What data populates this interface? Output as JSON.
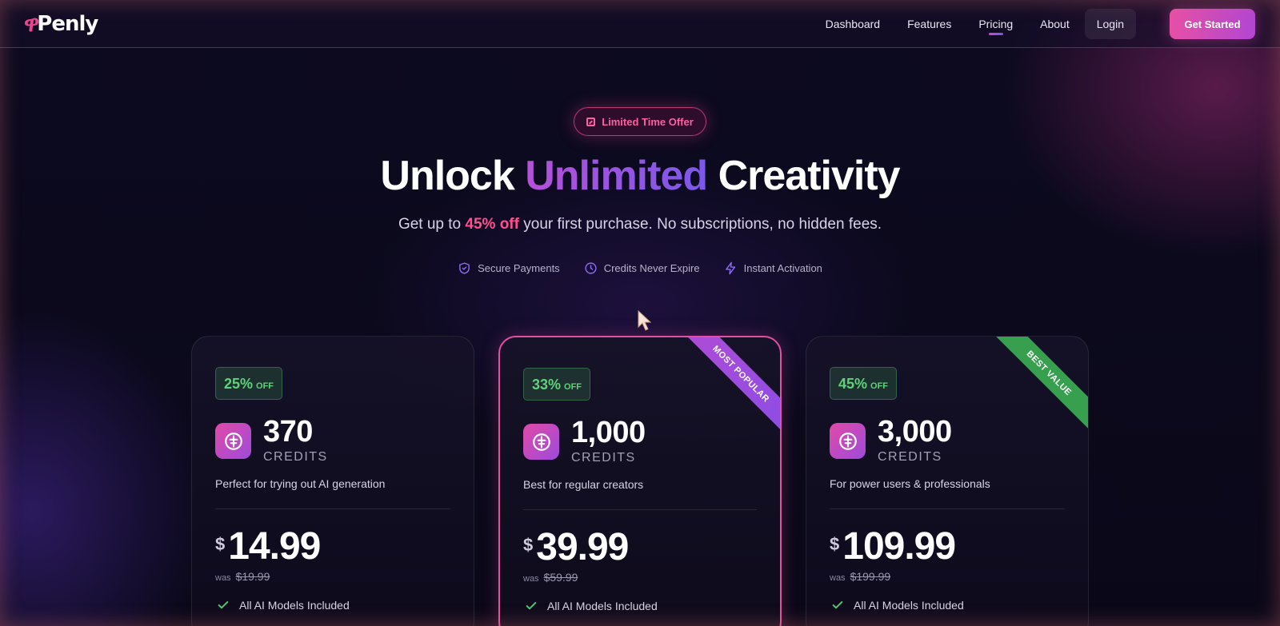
{
  "nav": {
    "logo": "Penly",
    "links": [
      "Dashboard",
      "Features",
      "Pricing",
      "About"
    ],
    "active": "Pricing",
    "login": "Login",
    "cta": "Get Started"
  },
  "hero": {
    "pill": "Limited Time Offer",
    "headline_pre": "Unlock ",
    "headline_accent": "Unlimited",
    "headline_post": " Creativity",
    "sub_pre": "Get up to ",
    "sub_highlight": "45% off",
    "sub_post": " your first purchase. No subscriptions, no hidden fees.",
    "features": [
      {
        "label": "Secure Payments",
        "icon": "shield-icon"
      },
      {
        "label": "Credits Never Expire",
        "icon": "clock-icon"
      },
      {
        "label": "Instant Activation",
        "icon": "lightning-icon"
      }
    ]
  },
  "plans": [
    {
      "discount": "25%",
      "off": "OFF",
      "credits": "370",
      "credits_label": "CREDITS",
      "description": "Perfect for trying out AI generation",
      "currency": "$",
      "price": "14.99",
      "was_label": "was",
      "was_price": "$19.99",
      "included": "All AI Models Included",
      "ribbon": ""
    },
    {
      "discount": "33%",
      "off": "OFF",
      "credits": "1,000",
      "credits_label": "CREDITS",
      "description": "Best for regular creators",
      "currency": "$",
      "price": "39.99",
      "was_label": "was",
      "was_price": "$59.99",
      "included": "All AI Models Included",
      "ribbon": "MOST POPULAR"
    },
    {
      "discount": "45%",
      "off": "OFF",
      "credits": "3,000",
      "credits_label": "CREDITS",
      "description": "For power users & professionals",
      "currency": "$",
      "price": "109.99",
      "was_label": "was",
      "was_price": "$199.99",
      "included": "All AI Models Included",
      "ribbon": "BEST VALUE"
    }
  ],
  "colors": {
    "accent_pink": "#e650a6",
    "accent_purple": "#9d4bdc",
    "discount_green": "#5fd27a",
    "background": "#0b0819"
  }
}
